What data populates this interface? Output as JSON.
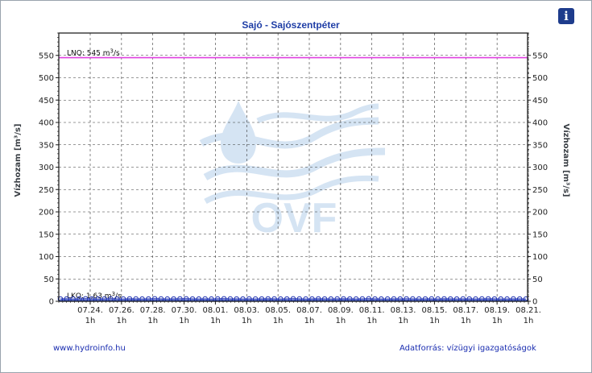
{
  "chart_data": {
    "type": "line",
    "title": "Sajó - Sajószentpéter",
    "ylabel_left": "Vízhozam [m³/s]",
    "ylabel_right": "Vízhozam [m³/s]",
    "ylim": [
      0,
      600
    ],
    "yticks": [
      0,
      50,
      100,
      150,
      200,
      250,
      300,
      350,
      400,
      450,
      500,
      550
    ],
    "x_range": [
      "07.22. 12h",
      "08.21. 1h"
    ],
    "xticks": [
      {
        "date": "07.24.",
        "hour": "1h"
      },
      {
        "date": "07.26.",
        "hour": "1h"
      },
      {
        "date": "07.28.",
        "hour": "1h"
      },
      {
        "date": "07.30.",
        "hour": "1h"
      },
      {
        "date": "08.01.",
        "hour": "1h"
      },
      {
        "date": "08.03.",
        "hour": "1h"
      },
      {
        "date": "08.05.",
        "hour": "1h"
      },
      {
        "date": "08.07.",
        "hour": "1h"
      },
      {
        "date": "08.09.",
        "hour": "1h"
      },
      {
        "date": "08.11.",
        "hour": "1h"
      },
      {
        "date": "08.13.",
        "hour": "1h"
      },
      {
        "date": "08.15.",
        "hour": "1h"
      },
      {
        "date": "08.17.",
        "hour": "1h"
      },
      {
        "date": "08.19.",
        "hour": "1h"
      },
      {
        "date": "08.21.",
        "hour": "1h"
      }
    ],
    "grid": true,
    "reference_lines": [
      {
        "label": "LNQ: 545",
        "unit": "m³/s",
        "value": 545,
        "color": "#e040e0"
      },
      {
        "label": "LKQ: 1,63",
        "unit": "m³/s",
        "value": 1.63,
        "color": "#3050c0"
      }
    ],
    "series": [
      {
        "color": "#1c2fb0",
        "marker": "circle",
        "values": [
          5.2,
          5.4,
          5.1,
          5.3,
          5.6,
          5.2,
          5.0,
          5.3,
          5.5,
          5.2,
          5.1,
          5.4,
          5.3,
          5.0,
          5.2,
          5.6,
          5.3,
          5.1,
          5.2,
          5.4,
          5.5,
          5.2,
          5.0,
          5.3,
          5.1,
          5.4,
          5.6,
          5.3,
          5.2,
          5.0,
          5.3,
          5.1,
          5.2,
          5.4,
          5.3,
          5.0,
          5.2,
          5.5,
          5.3,
          5.1,
          5.2,
          5.4,
          5.2,
          5.0,
          5.3,
          5.4,
          5.2,
          5.1,
          5.3,
          5.5,
          5.2,
          5.0,
          5.1,
          5.3,
          5.2,
          5.4,
          5.3,
          5.1,
          5.2,
          5.3,
          5.1,
          5.4,
          5.2,
          5.0,
          5.3,
          5.2,
          5.1,
          5.3,
          5.4,
          5.2,
          5.0,
          5.1,
          5.3,
          5.2,
          5.1
        ]
      }
    ]
  },
  "watermark": {
    "text": "OVF"
  },
  "footer": {
    "left": "www.hydroinfo.hu",
    "right": "Adatforrás: vízügyi igazgatóságok"
  },
  "info_button": {
    "label": "i",
    "icon": "info-icon"
  }
}
